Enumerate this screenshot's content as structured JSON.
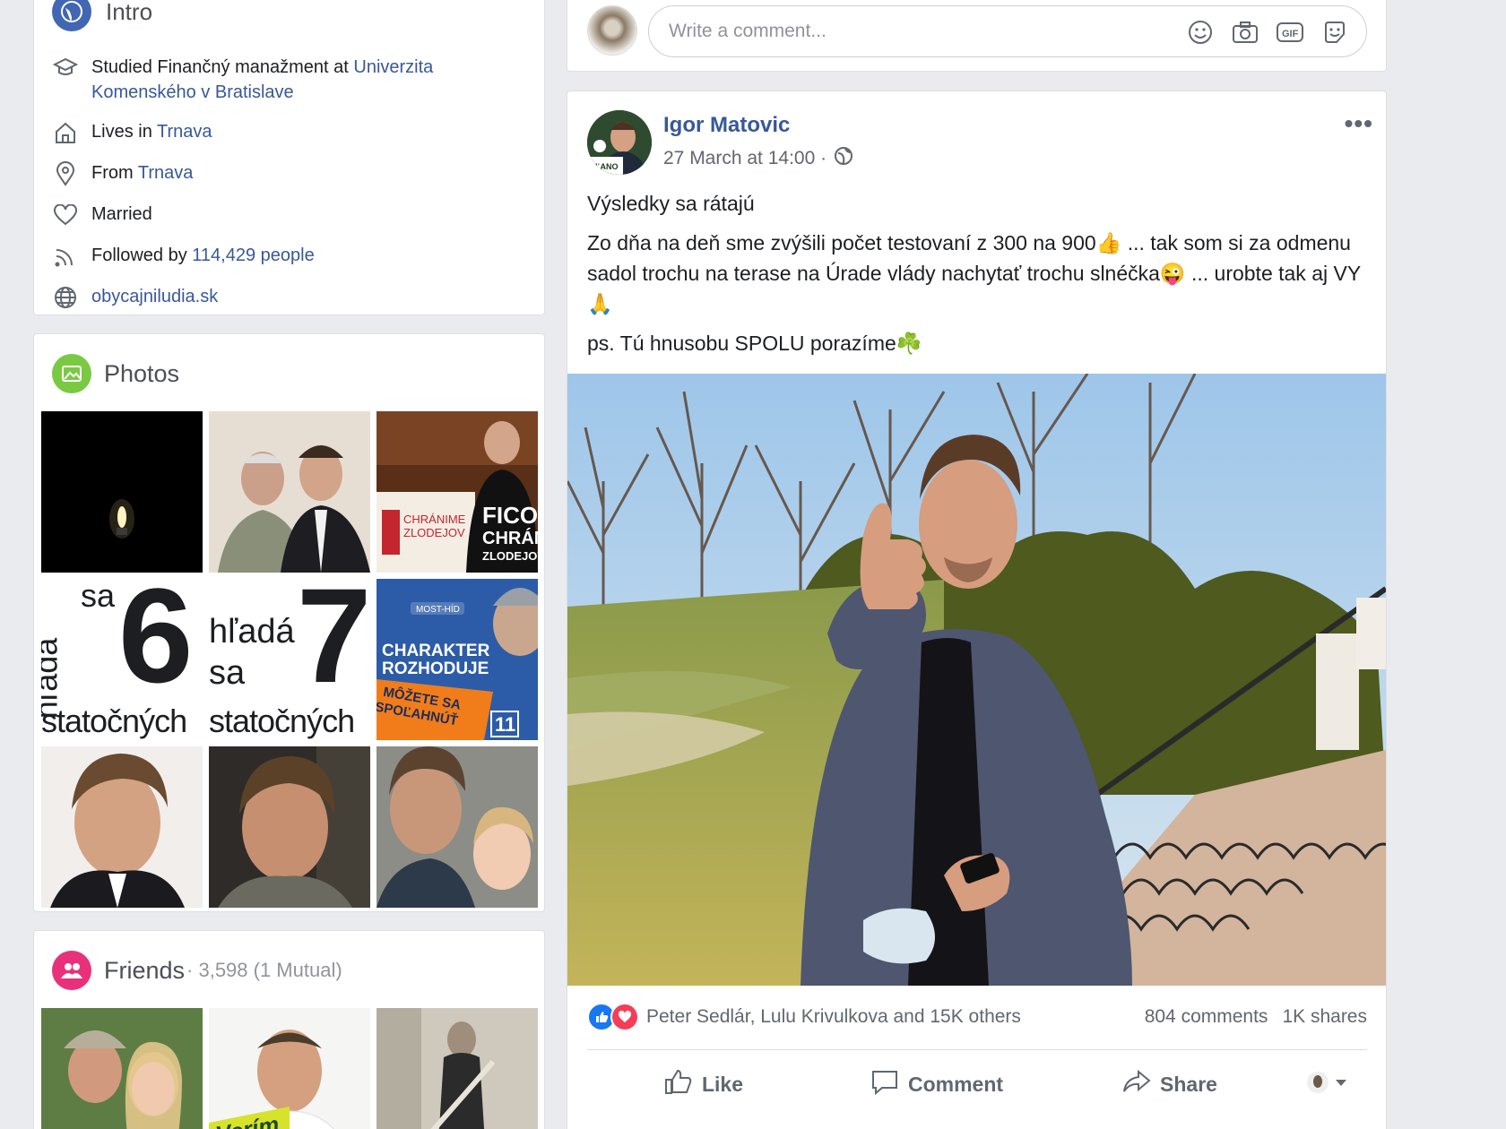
{
  "intro": {
    "title": "Intro",
    "education_prefix": "Studied Finančný manažment at ",
    "education_link": "Univerzita Komenského v Bratislave",
    "lives_prefix": "Lives in ",
    "lives_link": "Trnava",
    "from_prefix": "From ",
    "from_link": "Trnava",
    "relationship": "Married",
    "followed_prefix": "Followed by ",
    "followed_link": "114,429 people",
    "website": "obycajniludia.sk"
  },
  "photos": {
    "title": "Photos",
    "tile4": {
      "word1": "hľadá",
      "word2": "sa",
      "number": "6",
      "bottom": "statočných"
    },
    "tile5": {
      "word1": "hľadá",
      "word2": "sa",
      "number": "7",
      "bottom": "statočných"
    },
    "tile3": {
      "sign1": "CHRÁNIME",
      "sign2": "ZLODEJOV",
      "shirt1": "FICO",
      "shirt2": "CHRÁNI",
      "shirt3": "ZLODEJOV"
    },
    "tile6": {
      "brand": "MOST-HÍD",
      "line1": "CHARAKTER",
      "line2": "ROZHODUJE",
      "line3": "MÔŽETE SA",
      "line4": "SPOĽAHNÚŤ",
      "number": "11"
    }
  },
  "friends": {
    "title": "Friends",
    "count": " · 3,598 (1 Mutual)",
    "tile2_text": "Verím"
  },
  "comment_box": {
    "placeholder": "Write a comment..."
  },
  "post": {
    "author": "Igor Matovic",
    "avatar_badge": "OĽANO",
    "timestamp": "27 March at 14:00 ·",
    "text_title": "Výsledky sa rátajú",
    "text_body": "Zo dňa na deň sme zvýšili počet testovaní z 300 na 900👍 ... tak som si za odmenu sadol trochu na terase na Úrade vlády nachytať trochu slnéčka😜 ... urobte tak aj VY🙏",
    "text_ps": "ps. Tú hnusobu SPOLU porazíme☘️",
    "reactions": "Peter Sedlár, Lulu Krivulkova and 15K others",
    "comments": "804 comments",
    "shares": "1K shares",
    "like_label": "Like",
    "comment_label": "Comment",
    "share_label": "Share"
  },
  "colors": {
    "link": "#385898",
    "page_bg": "#e9ebee",
    "photos_icon": "#7ac943",
    "friends_icon": "#e9317b",
    "intro_icon": "#4267b2"
  }
}
